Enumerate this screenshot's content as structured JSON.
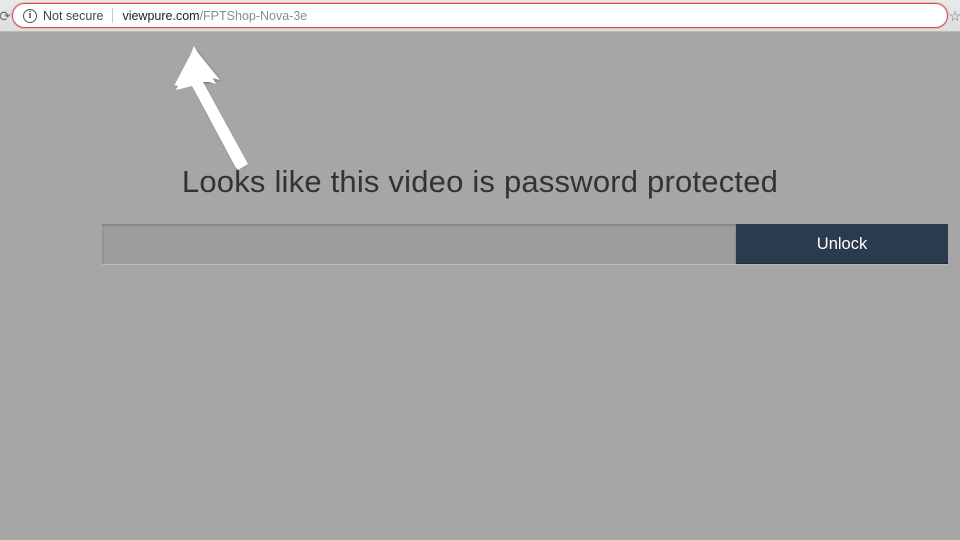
{
  "browser": {
    "security_label": "Not secure",
    "url_host": "viewpure.com",
    "url_path": "/FPTShop-Nova-3e"
  },
  "page": {
    "heading": "Looks like this video is password protected",
    "password_value": "",
    "unlock_label": "Unlock"
  }
}
